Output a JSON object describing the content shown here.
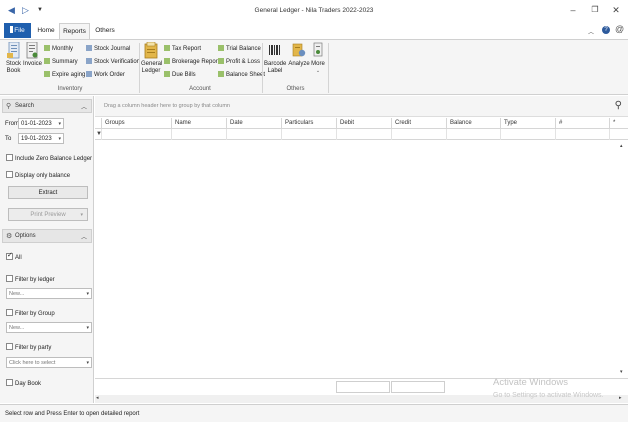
{
  "window": {
    "title": "General Ledger - Nila Traders 2022-2023",
    "quick_access": [
      "back-icon",
      "forward-icon",
      "customize-icon"
    ],
    "controls": [
      "minimize-icon",
      "restore-icon",
      "close-icon"
    ]
  },
  "tabs": {
    "file": "File",
    "items": [
      "Home",
      "Reports",
      "Others"
    ],
    "active": "Reports",
    "right_icons": [
      "collapse-icon",
      "help-icon",
      "settings-icon"
    ]
  },
  "ribbon": {
    "inventory": {
      "label": "Inventory",
      "stock_book": "Stock Book",
      "invoice": "Invoice",
      "monthly": "Monthly",
      "summary": "Summary",
      "expire_aging": "Expire aging",
      "stock_journal": "Stock Journal",
      "stock_verification": "Stock Verification",
      "work_order": "Work Order"
    },
    "account": {
      "label": "Account",
      "general_ledger": "General Ledger",
      "tax_report": "Tax Report",
      "brokerage_report": "Brokerage Report",
      "due_bills": "Due Bills",
      "trial_balance": "Trial Balance",
      "profit_loss": "Profit & Loss",
      "balance_sheet": "Balance Sheet"
    },
    "others": {
      "label": "Others",
      "barcode_label": "Barcode Label",
      "analyze": "Analyze",
      "more": "More"
    }
  },
  "search_panel": {
    "header": "Search",
    "from_label": "From",
    "from_value": "01-01-2023",
    "to_label": "To",
    "to_value": "19-01-2023",
    "include_zero": "Include Zero Balance Ledger",
    "display_only_balance": "Display only balance",
    "extract": "Extract",
    "print_preview": "Print Preview"
  },
  "options_panel": {
    "header": "Options",
    "all": "All",
    "filter_ledger": "Filter by ledger",
    "ledger_value": "New...",
    "filter_group": "Filter by Group",
    "group_value": "New...",
    "filter_party": "Filter by party",
    "party_placeholder": "Click here to select",
    "day_book": "Day Book"
  },
  "grid": {
    "group_hint": "Drag a column header here to group by that column",
    "columns": [
      "Groups",
      "Name",
      "Date",
      "Particulars",
      "Debit",
      "Credit",
      "Balance",
      "Type",
      "#",
      "*"
    ]
  },
  "watermark": {
    "line1": "Activate Windows",
    "line2": "Go to Settings to activate Windows."
  },
  "status": {
    "text": "Select row and Press Enter to open detailed report"
  },
  "colors": {
    "accent": "#1f5fae",
    "ribbon_bg": "#f5f5f5"
  }
}
